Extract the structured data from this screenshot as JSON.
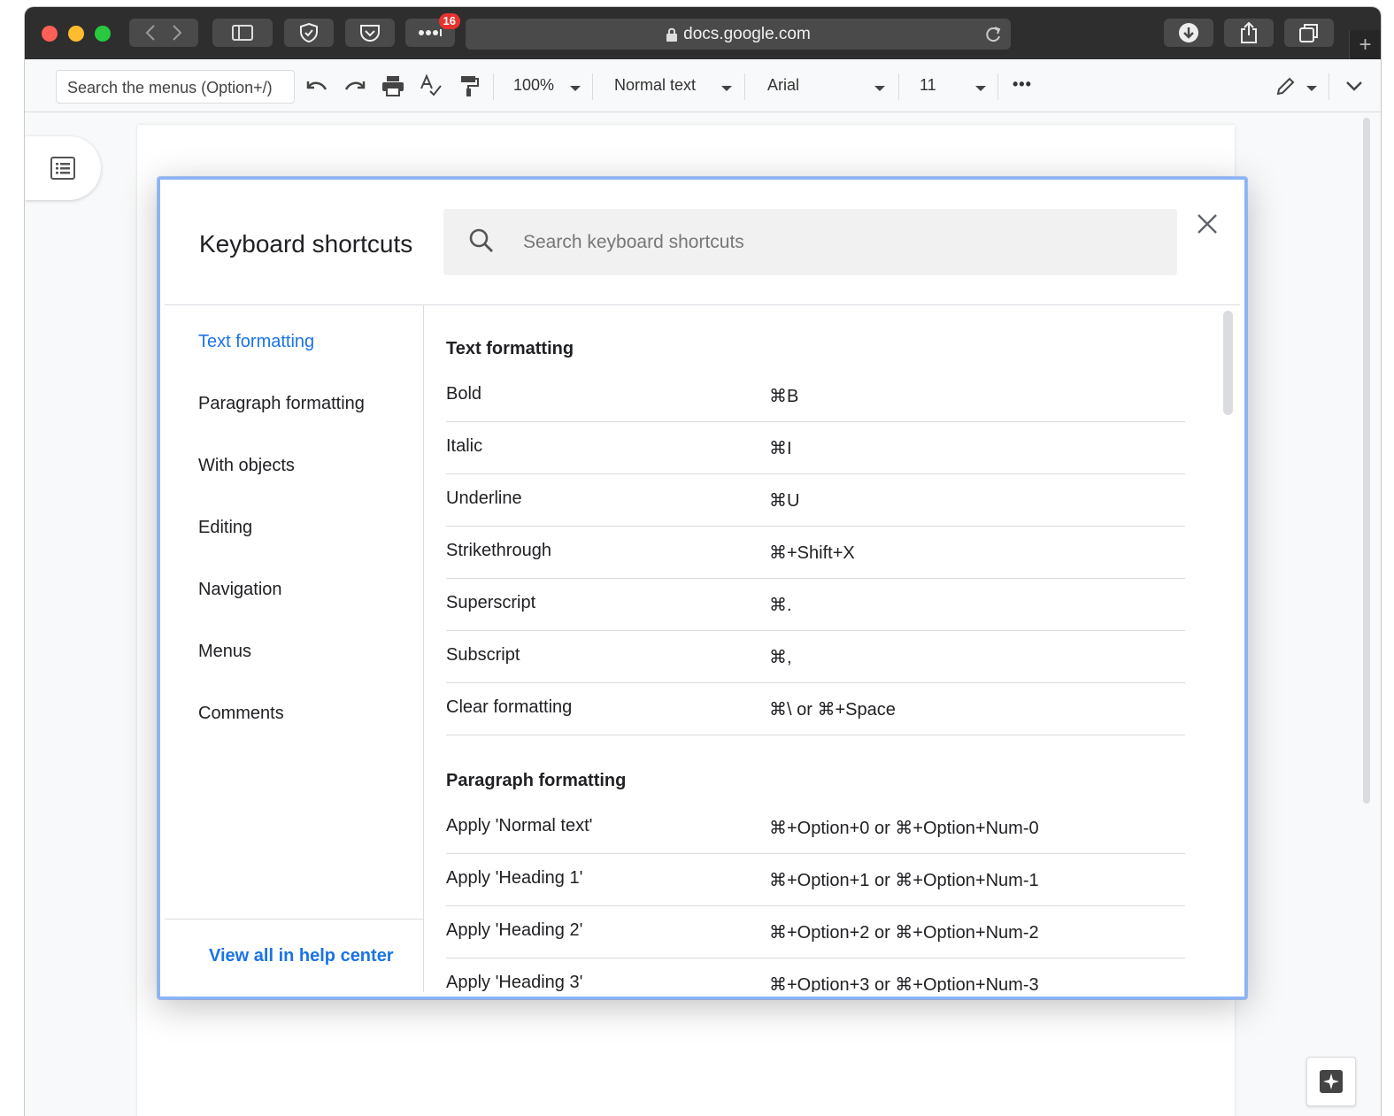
{
  "browser": {
    "url": "docs.google.com",
    "tab_badge": "16"
  },
  "toolbar": {
    "menu_search_placeholder": "Search the menus (Option+/)",
    "zoom": "100%",
    "style": "Normal text",
    "font": "Arial",
    "font_size": "11",
    "more": "•••"
  },
  "dialog": {
    "title": "Keyboard shortcuts",
    "search_placeholder": "Search keyboard shortcuts",
    "nav": [
      {
        "label": "Text formatting"
      },
      {
        "label": "Paragraph formatting"
      },
      {
        "label": "With objects"
      },
      {
        "label": "Editing"
      },
      {
        "label": "Navigation"
      },
      {
        "label": "Menus"
      },
      {
        "label": "Comments"
      }
    ],
    "help_link": "View all in help center",
    "sections": [
      {
        "title": "Text formatting",
        "rows": [
          {
            "action": "Bold",
            "keys": "⌘B"
          },
          {
            "action": "Italic",
            "keys": "⌘I"
          },
          {
            "action": "Underline",
            "keys": "⌘U"
          },
          {
            "action": "Strikethrough",
            "keys": "⌘+Shift+X"
          },
          {
            "action": "Superscript",
            "keys": "⌘."
          },
          {
            "action": "Subscript",
            "keys": "⌘,"
          },
          {
            "action": "Clear formatting",
            "keys": "⌘\\ or ⌘+Space"
          }
        ]
      },
      {
        "title": "Paragraph formatting",
        "rows": [
          {
            "action": "Apply 'Normal text'",
            "keys": "⌘+Option+0 or ⌘+Option+Num-0"
          },
          {
            "action": "Apply 'Heading 1'",
            "keys": "⌘+Option+1 or ⌘+Option+Num-1"
          },
          {
            "action": "Apply 'Heading 2'",
            "keys": "⌘+Option+2 or ⌘+Option+Num-2"
          },
          {
            "action": "Apply 'Heading 3'",
            "keys": "⌘+Option+3 or ⌘+Option+Num-3"
          }
        ]
      }
    ]
  },
  "colors": {
    "accent": "#1a73e8",
    "focus_ring": "#8ab4f8"
  }
}
